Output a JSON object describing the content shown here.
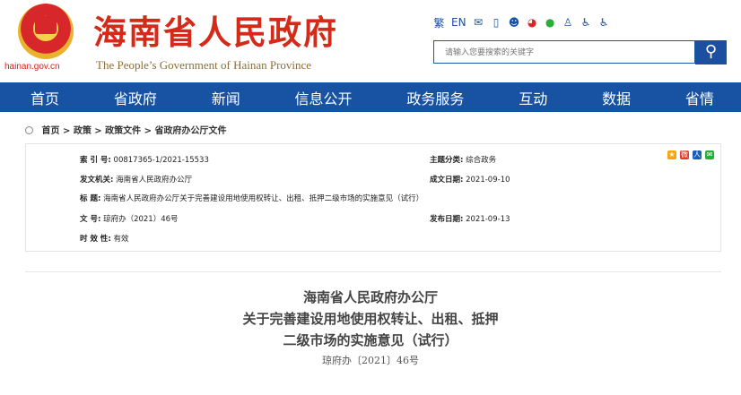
{
  "header": {
    "site_domain": "hainan.gov.cn",
    "site_title": "海南省人民政府",
    "site_subtitle": "The People’s Government  of Hainan Province"
  },
  "toolbar": {
    "traditional": "繁",
    "english": "EN",
    "icons": [
      "mail-icon",
      "mobile-icon",
      "robot-icon",
      "weibo-icon",
      "wechat-icon",
      "user-icon",
      "accessibility-icon",
      "elderly-mode-icon"
    ]
  },
  "search": {
    "placeholder": "请输入您要搜索的关键字",
    "button_icon": "search-icon"
  },
  "nav": [
    "首页",
    "省政府",
    "新闻",
    "信息公开",
    "政务服务",
    "互动",
    "数据",
    "省情"
  ],
  "breadcrumb": [
    "首页",
    "政策",
    "政策文件",
    "省政府办公厅文件"
  ],
  "meta": {
    "index_label": "索 引 号:",
    "index_value": "00817365-1/2021-15533",
    "topic_label": "主题分类:",
    "topic_value": "综合政务",
    "issuer_label": "发文机关:",
    "issuer_value": "海南省人民政府办公厅",
    "date_label": "成文日期:",
    "date_value": "2021-09-10",
    "subject_label": "标 题:",
    "subject_value": "海南省人民政府办公厅关于完善建设用地使用权转让、出租、抵押二级市场的实施意见（试行）",
    "docno_label": "文 号:",
    "docno_value": "琼府办（2021）46号",
    "pubdate_label": "发布日期:",
    "pubdate_value": "2021-09-13",
    "validity_label": "时 效 性:",
    "validity_value": "有效",
    "share_icons": [
      "qzone-share-icon",
      "weibo-share-icon",
      "renren-share-icon",
      "wechat-share-icon"
    ]
  },
  "document": {
    "title_lines": [
      "海南省人民政府办公厅",
      "关于完善建设用地使用权转让、出租、抵押",
      "二级市场的实施意见（试行）"
    ],
    "number": "琼府办〔2021〕46号"
  },
  "colors": {
    "brand_red": "#d32a1a",
    "nav_blue": "#1752a3"
  }
}
